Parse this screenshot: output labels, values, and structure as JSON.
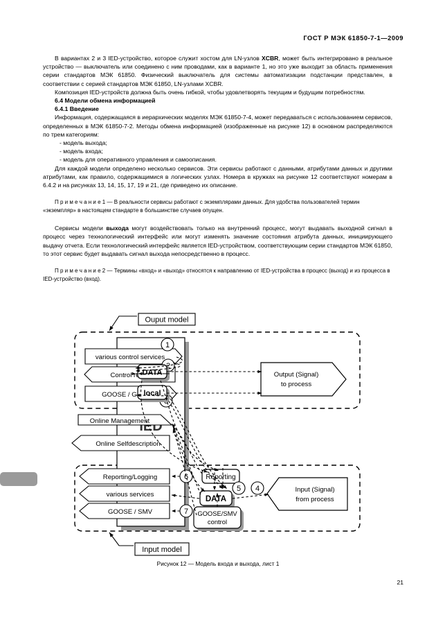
{
  "header": {
    "standard_title": "ГОСТ Р МЭК 61850-7-1—2009"
  },
  "body": {
    "p1": "В вариантах 2 и 3 IED-устройство, которое служит хостом для LN-узлов XCBR, может быть интегрировано в реальное устройство — выключатель или соединено с ним проводами, как в варианте 1, но это уже выходит за область применения серии стандартов МЭК 61850. Физический выключатель для системы автоматизации подстанции представлен, в соответствии с серией стандартов МЭК 61850, LN-узлами XCBR.",
    "p1_lead": "В вариантах 2 и 3 IED-устройство, которое служит хостом для LN-узлов ",
    "p1_bold": "XCBR",
    "p1_tail": ", может быть интегрировано в реальное устройство — выключатель или соединено с ним проводами, как в варианте 1, но это уже выходит за область применения серии стандартов МЭК 61850. Физический выключатель для системы автоматизации подстанции представлен, в соответствии с серией стандартов МЭК 61850, LN-узлами XCBR.",
    "p2": "Композиция IED-устройств должна быть очень гибкой, чтобы удовлетворять текущим и будущим потребностям.",
    "h1": "6.4 Модели обмена информацией",
    "h2": "6.4.1 Введение",
    "p3": "Информация, содержащаяся в иерархических моделях МЭК 61850-7-4, может передаваться с использованием сервисов, определенных в МЭК 61850-7-2. Методы обмена информацией (изображенные на рисунке 12) в основном распределяются по трем категориям:",
    "li1": "- модель выхода;",
    "li2": "- модель входа;",
    "li3": "- модель для оперативного управления и самоописания.",
    "p4": "Для каждой модели определено несколько сервисов. Эти сервисы работают с данными, атрибутами данных и другими атрибутами, как правило, содержащимися в логических узлах. Номера в кружках на рисунке 12  соответствуют  номерам в 6.4.2 и на рисунках 13, 14, 15, 17, 19 и 21, где приведено их описание.",
    "note1": "П р и м е ч а н и е 1 — В реальности сервисы работают с экземплярами данных. Для удобства пользователей термин «экземпляр» в настоящем стандарте в большинстве случаев опущен.",
    "p5_lead": "Сервисы модели ",
    "p5_bold": "выхода",
    "p5_tail": " могут воздействовать только на внутренний процесс, могут выдавать выходной сигнал в процесс через технологический интерфейс или могут изменять значение состояния атрибута данных, инициирующего выдачу отчета. Если технологический интерфейс является IED-устройством, соответствующим серии стандартов МЭК 61850, то этот сервис будет выдавать сигнал выхода непосредственно в процесс.",
    "note2": "П р и м е ч а н и е 2 — Термины «вход» и «выход» относятся к направлению от IED-устройства в процесс (выход) и из процесса в IED-устройство (вход)."
  },
  "figure": {
    "caption": "Рисунок 12 — Модель входа и выхода, лист 1",
    "output_model_label": "Ouput model",
    "input_model_label": "Input model",
    "ied_label": "IED",
    "output_services": [
      {
        "label": "various control services",
        "marker": "1",
        "shape": "arrow-right"
      },
      {
        "label": "Control response",
        "marker": "2",
        "shape": "arrow-left"
      },
      {
        "label": "GOOSE / GSSE",
        "marker": "3",
        "shape": "arrow-right"
      }
    ],
    "management_services": [
      {
        "label": "Online Management",
        "shape": "arrow-right"
      },
      {
        "label": "Online Selfdescription",
        "shape": "arrow-left"
      }
    ],
    "input_services": [
      {
        "label": "Reporting/Logging",
        "marker": "6",
        "shape": "arrow-left"
      },
      {
        "label": "various services",
        "marker": "",
        "shape": "arrow-left"
      },
      {
        "label": "GOOSE / SMV",
        "marker": "7",
        "shape": "arrow-left"
      }
    ],
    "ied_blocks_top": [
      {
        "label": "DATA"
      },
      {
        "label": "local"
      }
    ],
    "ied_blocks_bottom": [
      {
        "label": "Reporting"
      },
      {
        "label": "DATA"
      },
      {
        "label": "GOOSE/SMV\ncontrol",
        "line1": "GOOSE/SMV",
        "line2": "control"
      }
    ],
    "process_output": {
      "line1": "Output (Signal)",
      "line2": "to process"
    },
    "process_input": {
      "line1": "Input (Signal)",
      "line2": "from process",
      "marker": "4"
    },
    "marker_5": "5",
    "colors": {
      "line": "#000000",
      "shadow": "#9a9a9a",
      "fill": "#ffffff"
    }
  },
  "folio": {
    "page_number": "21"
  }
}
